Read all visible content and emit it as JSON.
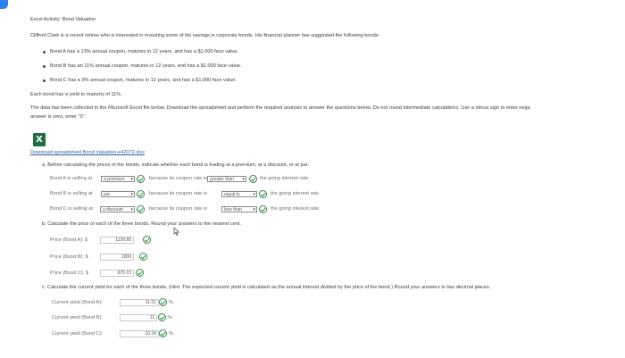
{
  "header": {
    "title": "Excel Activity: Bond Valuation"
  },
  "intro": "Clifford Clark is a recent retiree who is interested in investing some of his savings in corporate bonds. His financial planner has suggested the following bonds:",
  "bonds": [
    "Bond A has a 13% annual coupon, matures in 12 years, and has a $1,000 face value.",
    "Bond B has an 11% annual coupon, matures in 12 years, and has a $1,000 face value.",
    "Bond C has a 9% annual coupon, matures in 12 years, and has a $1,000 face value."
  ],
  "ytm_text": "Each bond has a yield to maturity of 11%.",
  "data_text": "The data has been collected in the Microsoft Excel file below. Download the spreadsheet and perform the required analysis to answer the questions below. Do not round intermediate calculations. Use a minus sign to enter nega",
  "data_text2": "answer is zero, enter \"0\".",
  "download": {
    "icon": "X",
    "link": "Download spreadsheet Bond Valuation-e42072.xlsx"
  },
  "part_a": {
    "question": "a. Before calculating the prices of the bonds, indicate whether each bond is trading at a premium, at a discount, or at par.",
    "rows": [
      {
        "prefix": "Bond A is selling at",
        "status": "a premium",
        "mid": "because its coupon rate is",
        "compare": "greater than",
        "suffix": "the going interest rate."
      },
      {
        "prefix": "Bond B is selling at",
        "status": "par",
        "mid": "because its coupon rate is",
        "compare": "equal to",
        "suffix": "the going interest rate."
      },
      {
        "prefix": "Bond C is selling at",
        "status": "a discount",
        "mid": "because its coupon rate is",
        "compare": "less than",
        "suffix": "the going interest rate."
      }
    ]
  },
  "part_b": {
    "question": "b. Calculate the price of each of the three bonds. Round your answers to the nearest cent.",
    "rows": [
      {
        "label": "Price (Bond A): $",
        "value": "1129.85"
      },
      {
        "label": "Price (Bond B): $",
        "value": "1000"
      },
      {
        "label": "Price (Bond C): $",
        "value": "870.15"
      }
    ]
  },
  "part_c": {
    "question": "c. Calculate the current yield for each of the three bonds. (Hint: The expected current yield is calculated as the annual interest divided by the price of the bond.) Round your answers to two decimal places.",
    "unit": "%",
    "rows": [
      {
        "label": "Current yield (Bond A):",
        "value": "11.51"
      },
      {
        "label": "Current yield (Bond B):",
        "value": "11"
      },
      {
        "label": "Current yield (Bond C):",
        "value": "10.34"
      }
    ]
  }
}
